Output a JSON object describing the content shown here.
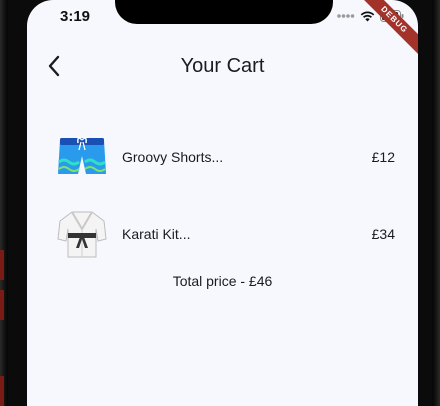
{
  "status_bar": {
    "time": "3:19",
    "debug_banner": "DEBUG"
  },
  "app_bar": {
    "title": "Your Cart"
  },
  "cart": {
    "items": [
      {
        "name": "Groovy Shorts...",
        "price": "£12",
        "icon": "swim-shorts-icon"
      },
      {
        "name": "Karati Kit...",
        "price": "£34",
        "icon": "martial-arts-uniform-icon"
      }
    ],
    "total_text": "Total price - £46"
  },
  "colors": {
    "background": "#f7f7fe",
    "text": "#1b1b1f",
    "debug_ribbon": "#a3322a"
  }
}
